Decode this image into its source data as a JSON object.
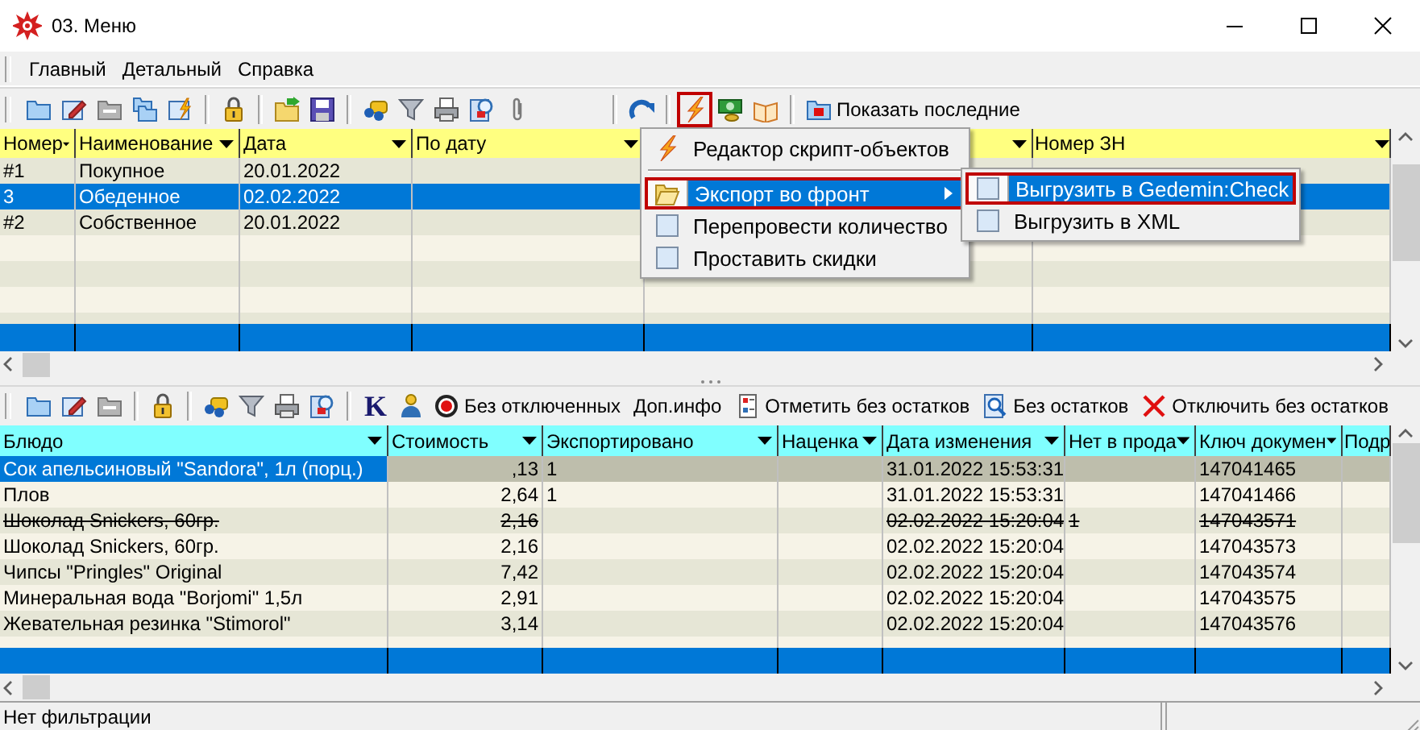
{
  "window": {
    "title": "03. Меню"
  },
  "menu_bar": [
    "Главный",
    "Детальный",
    "Справка"
  ],
  "toolbar": [
    {
      "kind": "folder",
      "outlined": false
    },
    {
      "kind": "pencil-document",
      "outlined": false
    },
    {
      "kind": "folder-gray",
      "outlined": false
    },
    {
      "kind": "folders",
      "outlined": false
    },
    {
      "kind": "lightning-document",
      "outlined": false
    },
    {
      "kind": "separator"
    },
    {
      "kind": "lock",
      "outlined": false
    },
    {
      "kind": "separator"
    },
    {
      "kind": "folder-arrow",
      "outlined": false
    },
    {
      "kind": "save",
      "outlined": false
    },
    {
      "kind": "separator"
    },
    {
      "kind": "binoculars",
      "outlined": false
    },
    {
      "kind": "filter",
      "outlined": false
    },
    {
      "kind": "printer",
      "outlined": false
    },
    {
      "kind": "magnifier-document",
      "outlined": false
    },
    {
      "kind": "paperclip",
      "outlined": false
    },
    {
      "kind": "spacer"
    },
    {
      "kind": "separator"
    },
    {
      "kind": "redo",
      "outlined": false
    },
    {
      "kind": "separator"
    },
    {
      "kind": "lightning",
      "outlined": true
    },
    {
      "kind": "banknote",
      "outlined": false
    },
    {
      "kind": "book",
      "outlined": false
    },
    {
      "kind": "separator"
    },
    {
      "kind": "record",
      "label": "Показать последние",
      "outlined": false
    }
  ],
  "top_table": {
    "columns": [
      {
        "label": "Номер",
        "filter": true
      },
      {
        "label": "Наименование",
        "filter": true
      },
      {
        "label": "Дата",
        "filter": true
      },
      {
        "label": "По дату",
        "filter": true
      },
      {
        "filter": true
      },
      {
        "label": "Номер ЗН",
        "filter": true
      }
    ],
    "rows": [
      {
        "cells": [
          "#1",
          "Покупное",
          "20.01.2022"
        ],
        "selected": false
      },
      {
        "cells": [
          "3",
          "Обеденное",
          "02.02.2022"
        ],
        "selected": true
      },
      {
        "cells": [
          "#2",
          "Собственное",
          "20.01.2022"
        ],
        "selected": false
      }
    ]
  },
  "context_menu": {
    "items": [
      {
        "kind": "command",
        "label": "Редактор скрипт-объектов",
        "selected": false,
        "outlined": false
      },
      {
        "kind": "separator"
      },
      {
        "kind": "submenu",
        "label": "Экспорт во фронт",
        "selected": true,
        "outlined": true
      },
      {
        "kind": "command",
        "label": "Перепровести количество",
        "selected": false,
        "outlined": false
      },
      {
        "kind": "command",
        "label": "Проставить скидки",
        "selected": false,
        "outlined": false
      }
    ],
    "submenu": [
      {
        "label": "Выгрузить в Gedemin:Check",
        "selected": true,
        "outlined": true
      },
      {
        "label": "Выгрузить в XML",
        "selected": false,
        "outlined": false
      }
    ]
  },
  "lower_toolbar": [
    {
      "kind": "folder",
      "outlined": false
    },
    {
      "kind": "pencil-document",
      "outlined": false
    },
    {
      "kind": "folder-gray",
      "outlined": false
    },
    {
      "kind": "separator"
    },
    {
      "kind": "lock",
      "outlined": false
    },
    {
      "kind": "separator"
    },
    {
      "kind": "binoculars",
      "outlined": false
    },
    {
      "kind": "filter",
      "outlined": false
    },
    {
      "kind": "printer",
      "outlined": false
    },
    {
      "kind": "magnifier-document",
      "outlined": false
    },
    {
      "kind": "separator"
    },
    {
      "kind": "letter",
      "label": "K",
      "outlined": false
    },
    {
      "kind": "person",
      "outlined": false
    },
    {
      "kind": "target",
      "label": "Без отключенных",
      "outlined": false
    },
    {
      "kind": "text",
      "label": "Доп.инфо",
      "outlined": false
    },
    {
      "kind": "checklist",
      "label": "Отметить без остатков",
      "outlined": false
    },
    {
      "kind": "search",
      "label": "Без остатков",
      "outlined": false
    },
    {
      "kind": "cross",
      "label": "Отключить без остатков",
      "outlined": false
    }
  ],
  "lower_table": {
    "columns": [
      {
        "label": "Блюдо",
        "filter": true
      },
      {
        "label": "Стоимость",
        "filter": true
      },
      {
        "label": "Экспортировано",
        "filter": true
      },
      {
        "label": "Наценка",
        "filter": true
      },
      {
        "label": "Дата изменения",
        "filter": true
      },
      {
        "label": "Нет в прода",
        "filter": true
      },
      {
        "label": "Ключ докумен",
        "filter": true
      },
      {
        "label": "Подр",
        "filter": false
      }
    ],
    "rows": [
      {
        "cells": [
          "Сок апельсиновый \"Sandora\", 1л (порц.)",
          ",13",
          "1",
          "",
          "31.01.2022 15:53:31",
          "",
          "147041465"
        ],
        "selected": true,
        "struck": false
      },
      {
        "cells": [
          "Плов",
          "2,64",
          "1",
          "",
          "31.01.2022 15:53:31",
          "",
          "147041466"
        ],
        "selected": false,
        "struck": false
      },
      {
        "cells": [
          "Шоколад Snickers, 60гр.",
          "2,16",
          "",
          "",
          "02.02.2022 15:20:04",
          "1",
          "147043571"
        ],
        "selected": false,
        "struck": true
      },
      {
        "cells": [
          "Шоколад Snickers, 60гр.",
          "2,16",
          "",
          "",
          "02.02.2022 15:20:04",
          "",
          "147043573"
        ],
        "selected": false,
        "struck": false
      },
      {
        "cells": [
          "Чипсы \"Pringles\" Original",
          "7,42",
          "",
          "",
          "02.02.2022 15:20:04",
          "",
          "147043574"
        ],
        "selected": false,
        "struck": false
      },
      {
        "cells": [
          "Минеральная вода \"Borjomi\" 1,5л",
          "2,91",
          "",
          "",
          "02.02.2022 15:20:04",
          "",
          "147043575"
        ],
        "selected": false,
        "struck": false
      },
      {
        "cells": [
          "Жевательная резинка \"Stimorol\"",
          "3,14",
          "",
          "",
          "02.02.2022 15:20:04",
          "",
          "147043576"
        ],
        "selected": false,
        "struck": false
      }
    ]
  },
  "status_bar": [
    "Нет фильтрации"
  ]
}
